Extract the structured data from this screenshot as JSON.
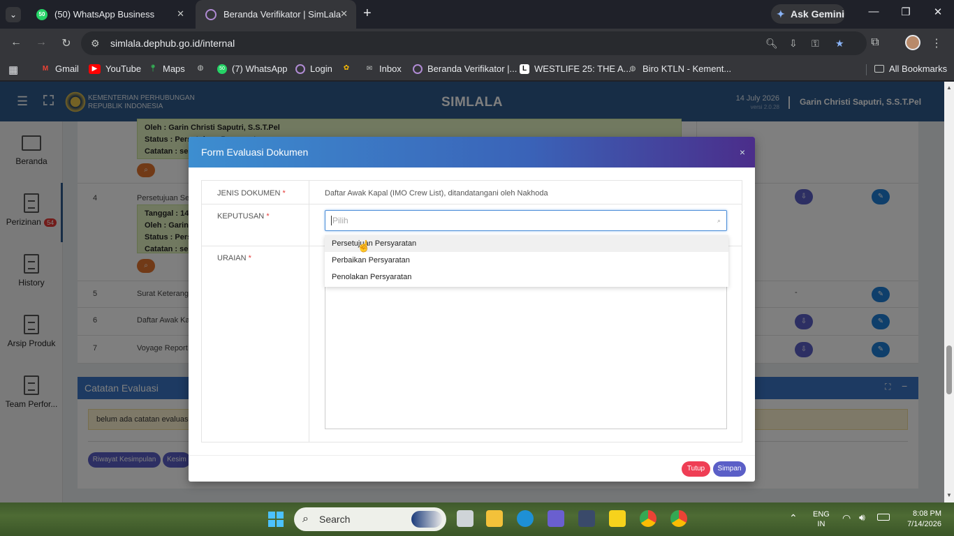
{
  "browser": {
    "tabs": [
      {
        "title": "(50) WhatsApp Business",
        "fav": "50"
      },
      {
        "title": "Beranda Verifikator | SimLala"
      }
    ],
    "ask_gemini": "Ask Gemini",
    "url": "simlala.dephub.go.id/internal",
    "bookmarks": [
      "Gmail",
      "YouTube",
      "Maps",
      "(7) WhatsApp",
      "Login",
      "Inbox",
      "Beranda Verifikator |...",
      "WESTLIFE 25: THE A...",
      "Biro KTLN - Kement..."
    ],
    "whatsapp_badge": "50",
    "all_bookmarks": "All Bookmarks"
  },
  "app": {
    "brand_line1": "KEMENTERIAN PERHUBUNGAN",
    "brand_line2": "REPUBLIK INDONESIA",
    "title": "SIMLALA",
    "date": "14 July 2026",
    "version": "versi 2.0.28",
    "user": "Garin Christi Saputri, S.S.T.Pel",
    "sidebar": [
      {
        "label": "Beranda"
      },
      {
        "label": "Perizinan",
        "badge": "54"
      },
      {
        "label": "History"
      },
      {
        "label": "Arsip Produk"
      },
      {
        "label": "Team Perfor..."
      }
    ],
    "rows": [
      {
        "no": "4",
        "name": "Persetujuan Seb"
      },
      {
        "no": "5",
        "name": "Surat Keterangan",
        "dash": "-"
      },
      {
        "no": "6",
        "name": "Daftar Awak Kap"
      },
      {
        "no": "7",
        "name": "Voyage Report ("
      }
    ],
    "note_top": {
      "oleh": "Oleh : Garin Christi Saputri, S.S.T.Pel",
      "status": "Status : Persetujuan Persyaratan",
      "catatan": "Catatan : ses"
    },
    "note_row4": {
      "tanggal": "Tanggal : 14",
      "oleh": "Oleh : Garin C",
      "status": "Status : Perse",
      "catatan": "Catatan : ses"
    },
    "catatan_title": "Catatan Evaluasi",
    "catatan_text": "belum ada catatan evaluasi",
    "btn_riwayat": "Riwayat Kesimpulan",
    "btn_kesim": "Kesim"
  },
  "modal": {
    "title": "Form Evaluasi Dokumen",
    "close": "×",
    "jenis_label": "JENIS DOKUMEN",
    "jenis_value": "Daftar Awak Kapal (IMO Crew List), ditandatangani oleh Nakhoda",
    "keputusan_label": "KEPUTUSAN",
    "select_placeholder": "Pilih",
    "options": [
      "Persetujuan Persyaratan",
      "Perbaikan Persyaratan",
      "Penolakan Persyaratan"
    ],
    "uraian_label": "URAIAN",
    "required": "*",
    "tutup": "Tutup",
    "simpan": "Simpan"
  },
  "taskbar": {
    "search": "Search",
    "lang1": "ENG",
    "lang2": "IN",
    "time": "8:08 PM",
    "date": "7/14/2026"
  }
}
